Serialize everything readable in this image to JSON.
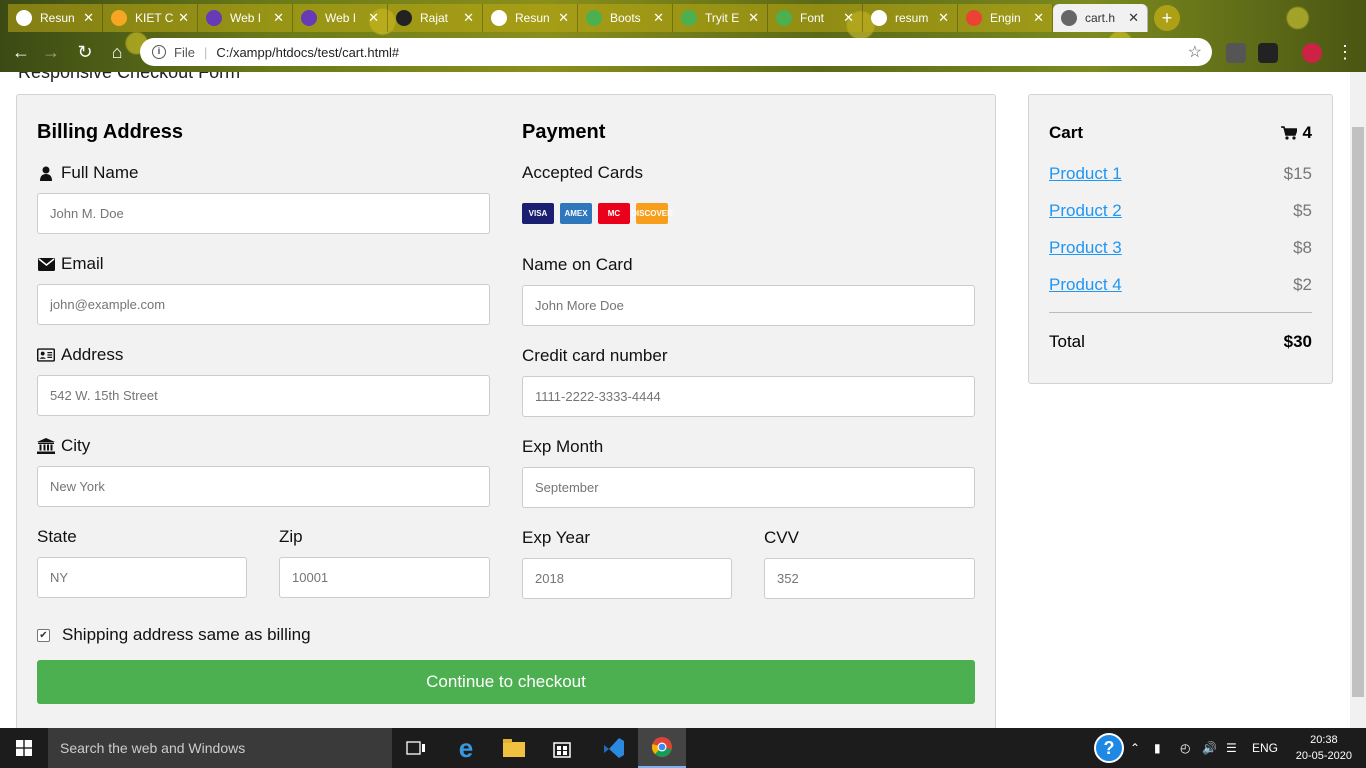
{
  "browser": {
    "tabs": [
      {
        "label": "Resun",
        "favicon_color": "#ffffff",
        "favicon": "globe-icon"
      },
      {
        "label": "KIET C",
        "favicon_color": "#f5a623",
        "favicon": "kiet-icon"
      },
      {
        "label": "Web I",
        "favicon_color": "#673ab7",
        "favicon": "list-icon"
      },
      {
        "label": "Web I",
        "favicon_color": "#673ab7",
        "favicon": "list-icon"
      },
      {
        "label": "Rajat",
        "favicon_color": "#222222",
        "favicon": "github-icon"
      },
      {
        "label": "Resun",
        "favicon_color": "#ffffff",
        "favicon": "globe-icon"
      },
      {
        "label": "Boots",
        "favicon_color": "#4caf50",
        "favicon": "w3-icon"
      },
      {
        "label": "Tryit E",
        "favicon_color": "#4caf50",
        "favicon": "w3-icon"
      },
      {
        "label": "Font",
        "favicon_color": "#4caf50",
        "favicon": "w3-icon"
      },
      {
        "label": "resum",
        "favicon_color": "#ffffff",
        "favicon": "google-icon"
      },
      {
        "label": "Engin",
        "favicon_color": "#ea4335",
        "favicon": "google-icon"
      },
      {
        "label": "cart.h",
        "favicon_color": "#666666",
        "favicon": "globe-icon"
      }
    ],
    "address": {
      "scheme_label": "File",
      "url": "C:/xampp/htdocs/test/cart.html#"
    }
  },
  "page": {
    "cut_heading": "Responsive Checkout Form",
    "billing": {
      "title": "Billing Address",
      "full_name_label": "Full Name",
      "full_name_placeholder": "John M. Doe",
      "email_label": "Email",
      "email_placeholder": "john@example.com",
      "address_label": "Address",
      "address_placeholder": "542 W. 15th Street",
      "city_label": "City",
      "city_placeholder": "New York",
      "state_label": "State",
      "state_placeholder": "NY",
      "zip_label": "Zip",
      "zip_placeholder": "10001"
    },
    "payment": {
      "title": "Payment",
      "accepted_cards_label": "Accepted Cards",
      "cards": [
        {
          "name": "VISA",
          "color": "#1a1f71"
        },
        {
          "name": "AMEX",
          "color": "#2e77bc"
        },
        {
          "name": "MC",
          "color": "#eb001b"
        },
        {
          "name": "DISCOVER",
          "color": "#f79e1b"
        }
      ],
      "name_on_card_label": "Name on Card",
      "name_on_card_placeholder": "John More Doe",
      "card_number_label": "Credit card number",
      "card_number_placeholder": "1111-2222-3333-4444",
      "exp_month_label": "Exp Month",
      "exp_month_placeholder": "September",
      "exp_year_label": "Exp Year",
      "exp_year_placeholder": "2018",
      "cvv_label": "CVV",
      "cvv_placeholder": "352"
    },
    "shipping_checkbox_label": "Shipping address same as billing",
    "shipping_checked": true,
    "checkout_button": "Continue to checkout",
    "accent_color": "#4caf50",
    "cart": {
      "title": "Cart",
      "count": "4",
      "items": [
        {
          "name": "Product 1",
          "price": "$15"
        },
        {
          "name": "Product 2",
          "price": "$5"
        },
        {
          "name": "Product 3",
          "price": "$8"
        },
        {
          "name": "Product 4",
          "price": "$2"
        }
      ],
      "total_label": "Total",
      "total_value": "$30"
    }
  },
  "taskbar": {
    "search_placeholder": "Search the web and Windows",
    "language": "ENG",
    "time": "20:38",
    "date": "20-05-2020"
  }
}
